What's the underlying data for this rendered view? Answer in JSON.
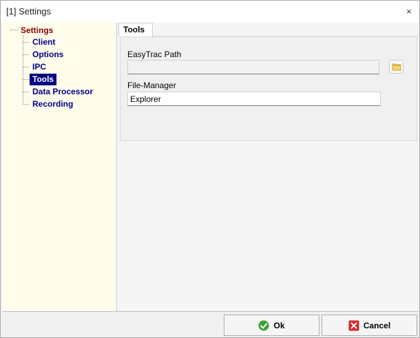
{
  "window": {
    "title": "[1] Settings",
    "close_glyph": "×"
  },
  "tree": {
    "root": "Settings",
    "items": [
      {
        "label": "Client"
      },
      {
        "label": "Options"
      },
      {
        "label": "IPC"
      },
      {
        "label": "Tools",
        "selected": true
      },
      {
        "label": "Data Processor"
      },
      {
        "label": "Recording"
      }
    ]
  },
  "tabs": {
    "active": "Tools"
  },
  "tools": {
    "easytrac_label": "EasyTrac Path",
    "easytrac_value": "",
    "filemanager_label": "File-Manager",
    "filemanager_value": "Explorer"
  },
  "footer": {
    "ok_label": "Ok",
    "cancel_label": "Cancel"
  },
  "colors": {
    "tree_bg": "#fffcec",
    "root_text": "#8b0000",
    "item_text": "#00008b",
    "selected_bg": "#000080"
  }
}
